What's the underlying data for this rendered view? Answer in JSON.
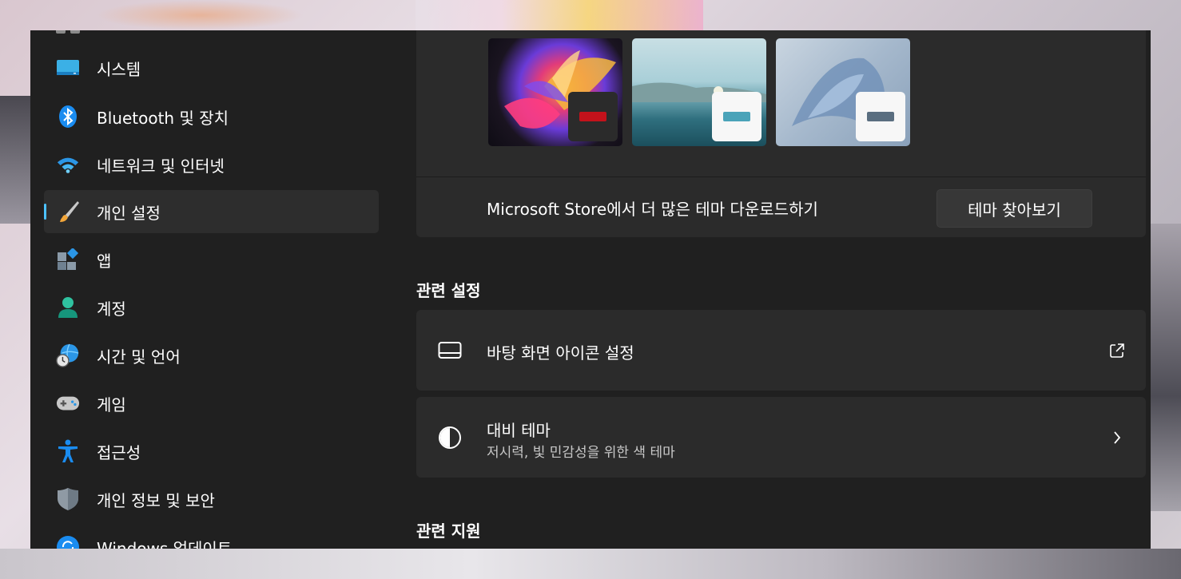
{
  "sidebar": {
    "items": [
      {
        "label": "시스템",
        "icon": "system-monitor-icon"
      },
      {
        "label": "Bluetooth 및 장치",
        "icon": "bluetooth-icon"
      },
      {
        "label": "네트워크 및 인터넷",
        "icon": "wifi-icon"
      },
      {
        "label": "개인 설정",
        "icon": "paintbrush-icon",
        "active": true
      },
      {
        "label": "앱",
        "icon": "apps-icon"
      },
      {
        "label": "계정",
        "icon": "account-icon"
      },
      {
        "label": "시간 및 언어",
        "icon": "time-language-icon"
      },
      {
        "label": "게임",
        "icon": "gamepad-icon"
      },
      {
        "label": "접근성",
        "icon": "accessibility-icon"
      },
      {
        "label": "개인 정보 및 보안",
        "icon": "shield-icon"
      },
      {
        "label": "Windows 업데이트",
        "icon": "windows-update-icon"
      }
    ]
  },
  "themes": {
    "thumbnails": [
      {
        "name": "glow-theme",
        "accent": "#c3121b"
      },
      {
        "name": "lake-theme",
        "accent": "#4aa3b9"
      },
      {
        "name": "bloom-theme",
        "accent": "#5a6e80"
      }
    ],
    "store_text": "Microsoft Store에서 더 많은 테마 다운로드하기",
    "store_button": "테마 찾아보기"
  },
  "related_settings": {
    "title": "관련 설정",
    "desktop_icons": {
      "title": "바탕 화면 아이콘 설정"
    },
    "contrast": {
      "title": "대비 테마",
      "subtitle": "저시력, 빛 민감성을 위한 색 테마"
    }
  },
  "related_support": {
    "title": "관련 지원"
  },
  "colors": {
    "accent": "#4cc2ff",
    "window_bg": "#202020",
    "card_bg": "#2b2b2b"
  }
}
